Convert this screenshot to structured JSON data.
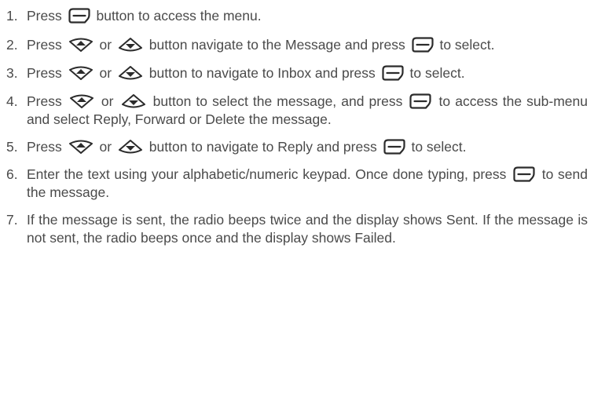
{
  "steps": [
    {
      "number": "1.",
      "segments": [
        {
          "t": "Press"
        },
        {
          "icon": "menu-button-icon"
        },
        {
          "t": "button to access the menu."
        }
      ]
    },
    {
      "number": "2.",
      "segments": [
        {
          "t": "Press"
        },
        {
          "icon": "up-button-icon"
        },
        {
          "t": "or"
        },
        {
          "icon": "down-button-icon"
        },
        {
          "t": "button navigate to the Message and press"
        },
        {
          "icon": "menu-button-icon"
        },
        {
          "t": "to select."
        }
      ]
    },
    {
      "number": "3.",
      "segments": [
        {
          "t": "Press"
        },
        {
          "icon": "up-button-icon"
        },
        {
          "t": "or"
        },
        {
          "icon": "down-button-icon"
        },
        {
          "t": "button to navigate to Inbox and press"
        },
        {
          "icon": "menu-button-icon"
        },
        {
          "t": "to select."
        }
      ]
    },
    {
      "number": "4.",
      "segments": [
        {
          "t": "Press"
        },
        {
          "icon": "up-button-icon"
        },
        {
          "t": "or"
        },
        {
          "icon": "down-button-icon"
        },
        {
          "t": "button to select the message, and press"
        },
        {
          "icon": "menu-button-icon"
        },
        {
          "t": "to access the sub-menu and select Reply, Forward or Delete the message."
        }
      ]
    },
    {
      "number": "5.",
      "segments": [
        {
          "t": "Press"
        },
        {
          "icon": "up-button-icon"
        },
        {
          "t": "or"
        },
        {
          "icon": "down-button-icon"
        },
        {
          "t": "button to navigate to Reply and press"
        },
        {
          "icon": "menu-button-icon"
        },
        {
          "t": "to select."
        }
      ]
    },
    {
      "number": "6.",
      "segments": [
        {
          "t": "Enter the text using your alphabetic/numeric keypad. Once done typing, press"
        },
        {
          "icon": "menu-button-icon"
        },
        {
          "t": "to send the message."
        }
      ]
    },
    {
      "number": "7.",
      "segments": [
        {
          "t": "If the message is sent, the radio beeps twice and the display shows Sent. If the message is not sent, the radio beeps once and the display shows Failed."
        }
      ]
    }
  ],
  "icons": {
    "menu-button-icon": {
      "meaning": "menu/ok button",
      "color": "#2b2b2b"
    },
    "up-button-icon": {
      "meaning": "up navigation button",
      "color": "#2b2b2b"
    },
    "down-button-icon": {
      "meaning": "down navigation button",
      "color": "#2b2b2b"
    }
  },
  "colors": {
    "text": "#4a4a4a",
    "icon": "#2b2b2b",
    "background": "#ffffff"
  }
}
